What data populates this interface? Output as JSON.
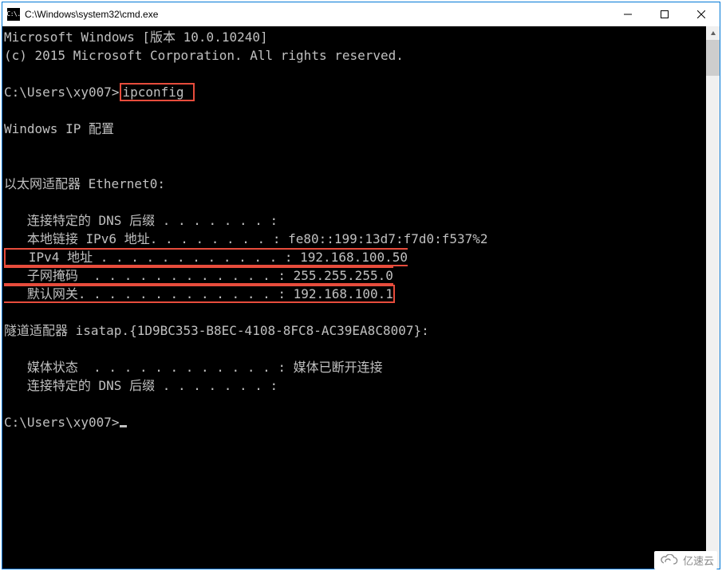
{
  "window": {
    "icon_text": "C:\\.",
    "title": "C:\\Windows\\system32\\cmd.exe"
  },
  "terminal": {
    "header_line1": "Microsoft Windows [版本 10.0.10240]",
    "header_line2": "(c) 2015 Microsoft Corporation. All rights reserved.",
    "prompt1_prefix": "C:\\Users\\xy007>",
    "prompt1_cmd": "ipconfig ",
    "heading": "Windows IP 配置",
    "adapter1_title": "以太网适配器 Ethernet0:",
    "adapter1": {
      "dns_suffix": "   连接特定的 DNS 后缀 . . . . . . . :",
      "ipv6": "   本地链接 IPv6 地址. . . . . . . . : fe80::199:13d7:f7d0:f537%2",
      "ipv4": "   IPv4 地址 . . . . . . . . . . . . : 192.168.100.50",
      "subnet": "   子网掩码  . . . . . . . . . . . . : 255.255.255.0",
      "gateway": "   默认网关. . . . . . . . . . . . . : 192.168.100.1"
    },
    "adapter2_title": "隧道适配器 isatap.{1D9BC353-B8EC-4108-8FC8-AC39EA8C8007}:",
    "adapter2": {
      "media": "   媒体状态  . . . . . . . . . . . . : 媒体已断开连接",
      "dns_suffix": "   连接特定的 DNS 后缀 . . . . . . . :"
    },
    "prompt2": "C:\\Users\\xy007>"
  },
  "watermark": {
    "text": "亿速云"
  },
  "colors": {
    "highlight": "#e74c3c",
    "term_fg": "#c0c0c0",
    "term_bg": "#000000"
  }
}
